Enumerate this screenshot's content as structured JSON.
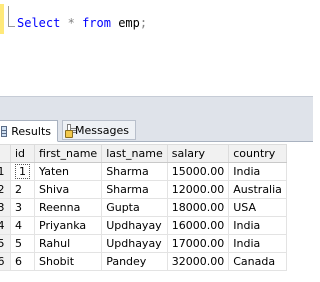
{
  "editor": {
    "tokens": [
      {
        "t": "Select",
        "cls": "kw"
      },
      {
        "t": " ",
        "cls": "plain"
      },
      {
        "t": "*",
        "cls": "op"
      },
      {
        "t": " ",
        "cls": "plain"
      },
      {
        "t": "from",
        "cls": "kw"
      },
      {
        "t": " emp",
        "cls": "plain"
      },
      {
        "t": ";",
        "cls": "op"
      }
    ]
  },
  "tabs": {
    "results_label": "Results",
    "messages_label": "Messages"
  },
  "grid": {
    "columns": [
      "id",
      "first_name",
      "last_name",
      "salary",
      "country"
    ],
    "rows": [
      {
        "rownum": "1",
        "cells": [
          "1",
          "Yaten",
          "Sharma",
          "15000.00",
          "India"
        ]
      },
      {
        "rownum": "2",
        "cells": [
          "2",
          "Shiva",
          "Sharma",
          "12000.00",
          "Australia"
        ]
      },
      {
        "rownum": "3",
        "cells": [
          "3",
          "Reenna",
          "Gupta",
          "18000.00",
          "USA"
        ]
      },
      {
        "rownum": "4",
        "cells": [
          "4",
          "Priyanka",
          "Updhayay",
          "16000.00",
          "India"
        ]
      },
      {
        "rownum": "5",
        "cells": [
          "5",
          "Rahul",
          "Updhayay",
          "17000.00",
          "India"
        ]
      },
      {
        "rownum": "6",
        "cells": [
          "6",
          "Shobit",
          "Pandey",
          "32000.00",
          "Canada"
        ]
      }
    ]
  },
  "colors": {
    "keyword": "#0000ff",
    "operator": "#808080",
    "panel": "#dfe3ea"
  }
}
